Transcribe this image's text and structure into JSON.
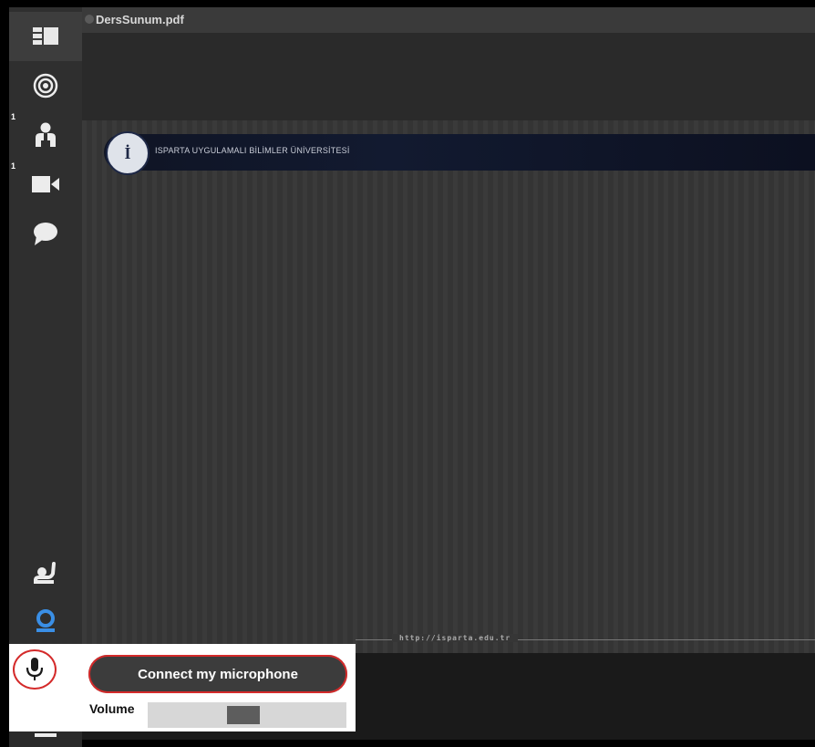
{
  "document": {
    "title": "DersSunum.pdf",
    "banner_text": "ISPARTA UYGULAMALI BİLİMLER ÜNİVERSİTESİ",
    "logo_letter": "İ",
    "footer_url": "http://isparta.edu.tr"
  },
  "sidebar": {
    "items": [
      {
        "icon": "layout-icon",
        "badge": ""
      },
      {
        "icon": "target-icon",
        "badge": ""
      },
      {
        "icon": "attendees-icon",
        "badge": "1"
      },
      {
        "icon": "video-camera-icon",
        "badge": "1"
      },
      {
        "icon": "chat-bubble-icon",
        "badge": ""
      },
      {
        "icon": "raise-hand-icon",
        "badge": ""
      },
      {
        "icon": "webcam-icon",
        "badge": ""
      },
      {
        "icon": "microphone-icon",
        "badge": ""
      },
      {
        "icon": "menu-icon",
        "badge": ""
      }
    ]
  },
  "mic_panel": {
    "connect_label": "Connect my microphone",
    "volume_label": "Volume",
    "volume_level": 0.48
  },
  "colors": {
    "highlight_red": "#d42a2a",
    "webcam_blue": "#3a8fe6",
    "sidebar_bg": "#2f2f2f"
  }
}
